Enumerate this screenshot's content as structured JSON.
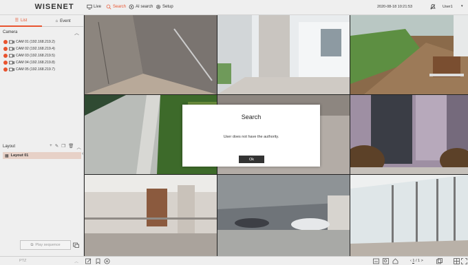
{
  "app": {
    "logo": "WISENET"
  },
  "topnav": [
    {
      "label": "Live",
      "icon": "monitor-icon",
      "active": false
    },
    {
      "label": "Search",
      "icon": "search-icon",
      "active": true
    },
    {
      "label": "AI search",
      "icon": "ai-search-icon",
      "active": false
    },
    {
      "label": "Setup",
      "icon": "gear-icon",
      "active": false
    }
  ],
  "header": {
    "datetime": "2020-08-18 10:21:53",
    "user": "User1"
  },
  "left_panel": {
    "tabs": [
      {
        "label": "List",
        "active": true
      },
      {
        "label": "Event",
        "active": false
      }
    ],
    "camera_section": "Camera",
    "cameras": [
      "CAM 01 (192.168.219.2)",
      "CAM 02 (192.168.219.4)",
      "CAM 03 (192.168.219.5)",
      "CAM 04 (192.168.219.8)",
      "CAM 05 (192.168.219.7)"
    ],
    "layout_section": "Layout",
    "layouts": [
      "Layout 01"
    ],
    "play_sequence": "Play sequence"
  },
  "bottom_bar": {
    "ptz_label": "PTZ",
    "page_current": "1",
    "page_total": "/ 1 >"
  },
  "dialog": {
    "title": "Search",
    "message": "User does not have the authority.",
    "ok_label": "Ok"
  },
  "colors": {
    "accent": "#e8532e",
    "panel_bg": "#efefef",
    "dialog_button": "#333333"
  }
}
